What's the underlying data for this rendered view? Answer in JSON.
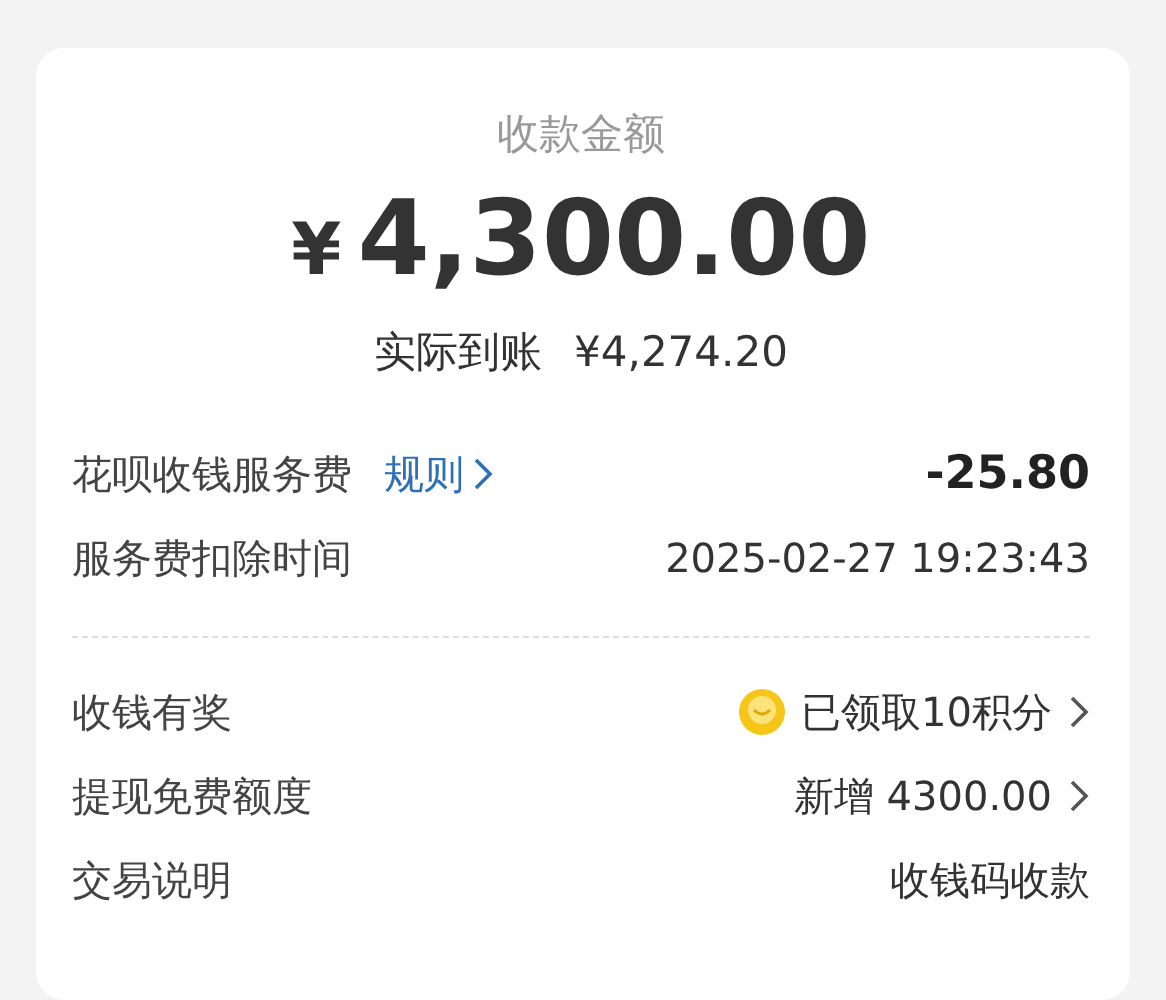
{
  "header": {
    "label": "收款金额",
    "currency": "¥",
    "amount": "4,300.00",
    "received_label": "实际到账",
    "received_amount": "¥4,274.20"
  },
  "fee_rows": [
    {
      "label": "花呗收钱服务费",
      "link": "规则",
      "value": "-25.80",
      "kind": "link"
    },
    {
      "label": "服务费扣除时间",
      "value": "2025-02-27 19:23:43",
      "kind": "plain"
    }
  ],
  "detail_rows": [
    {
      "label": "收钱有奖",
      "value": "已领取10积分",
      "kind": "reward"
    },
    {
      "label": "提现免费额度",
      "value": "新增 4300.00",
      "kind": "chevron"
    },
    {
      "label": "交易说明",
      "value": "收钱码收款",
      "kind": "plain"
    }
  ]
}
